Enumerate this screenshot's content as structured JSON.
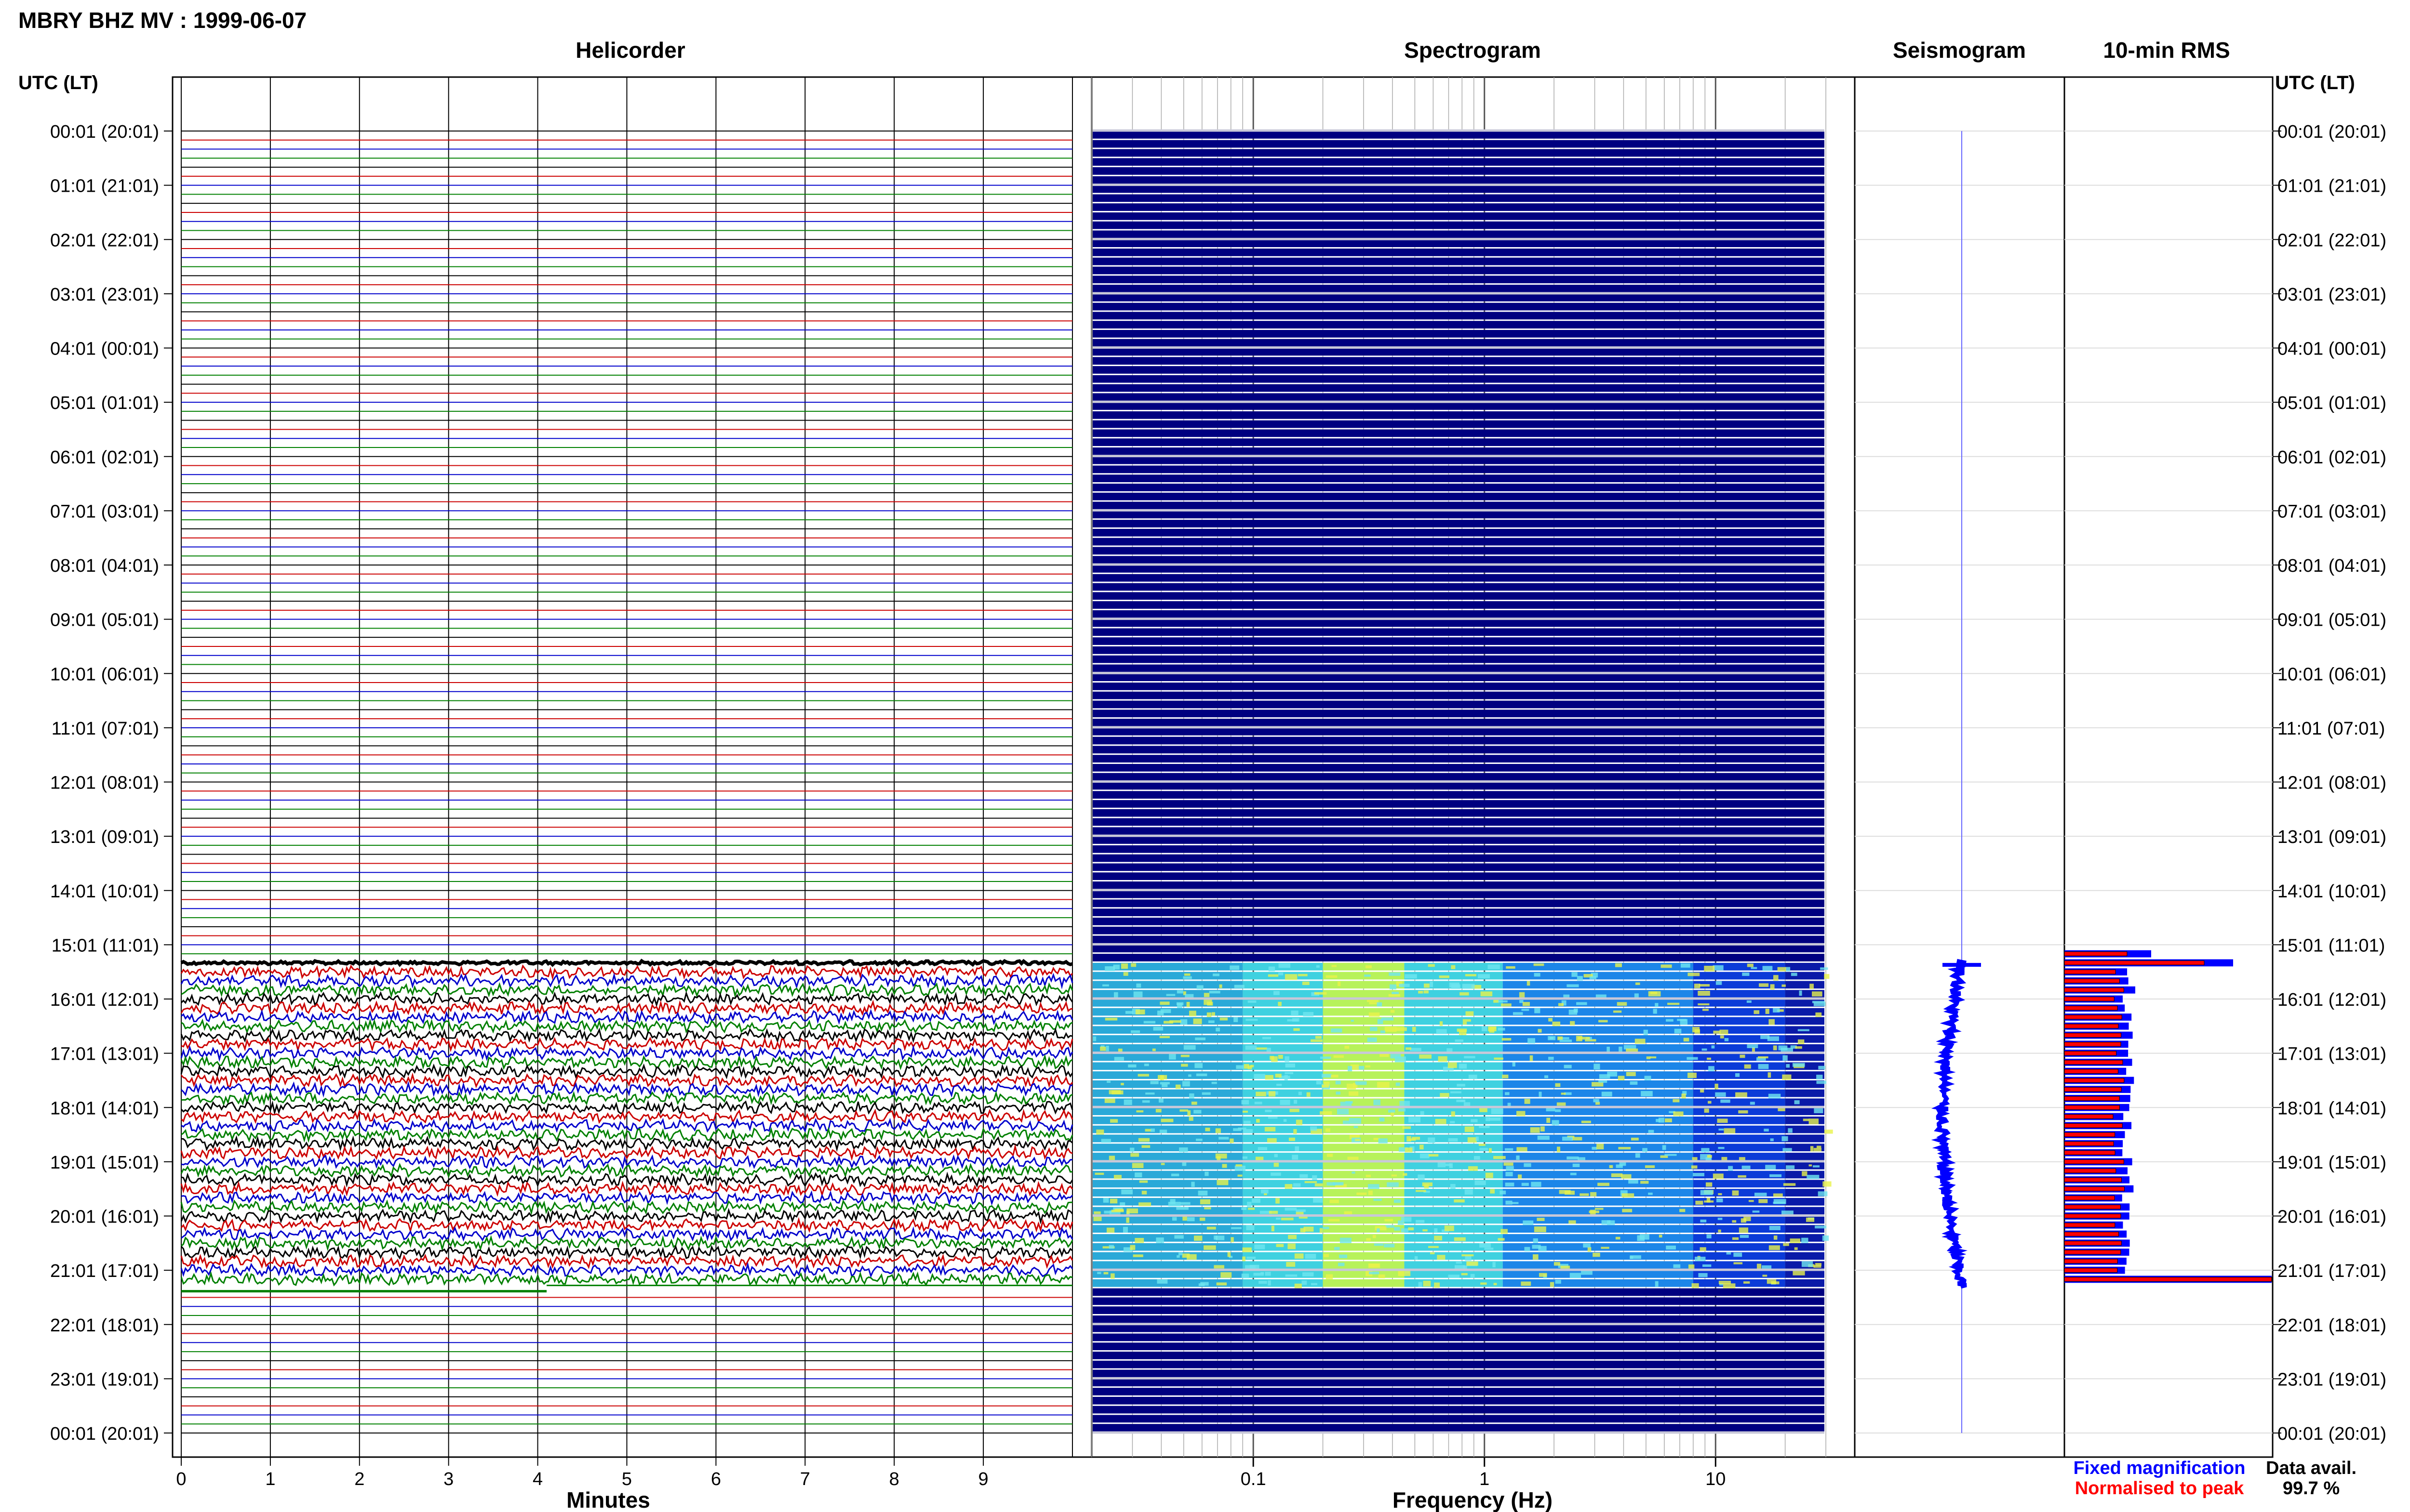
{
  "title": "MBRY BHZ MV : 1999-06-07",
  "panels": {
    "helicorder": "Helicorder",
    "spectrogram": "Spectrogram",
    "seismogram": "Seismogram",
    "rms": "10-min RMS"
  },
  "axis": {
    "time_header": "UTC (LT)",
    "helicorder_xlabel": "Minutes",
    "spectrogram_xlabel": "Frequency (Hz)"
  },
  "legend": {
    "fixed": "Fixed magnification",
    "normalised": "Normalised to peak",
    "fixed_color": "#0000ff",
    "normalised_color": "#ff0000"
  },
  "data_availability": {
    "label": "Data avail.",
    "value": "99.7 %"
  },
  "colors": {
    "trace_cycle": [
      "#000000",
      "#cc0000",
      "#0000cc",
      "#008000"
    ],
    "spectro_background": "#000080",
    "spectro_empty_line": "#c8c8d8"
  },
  "chart_data": [
    {
      "type": "line",
      "title": "Helicorder",
      "xlabel": "Minutes",
      "x_ticks": [
        "0",
        "1",
        "2",
        "3",
        "4",
        "5",
        "6",
        "7",
        "8",
        "9"
      ],
      "xlim": [
        0,
        10
      ],
      "row_labels": [
        "00:01 (20:01)",
        "01:01 (21:01)",
        "02:01 (22:01)",
        "03:01 (23:01)",
        "04:01 (00:01)",
        "05:01 (01:01)",
        "06:01 (02:01)",
        "07:01 (03:01)",
        "08:01 (04:01)",
        "09:01 (05:01)",
        "10:01 (06:01)",
        "11:01 (07:01)",
        "12:01 (08:01)",
        "13:01 (09:01)",
        "14:01 (10:01)",
        "15:01 (11:01)",
        "16:01 (12:01)",
        "17:01 (13:01)",
        "18:01 (14:01)",
        "19:01 (15:01)",
        "20:01 (16:01)",
        "21:01 (17:01)",
        "22:01 (18:01)",
        "23:01 (19:01)",
        "00:01 (20:01)"
      ],
      "minutes_per_line": 10,
      "data_start_hour": 15.3,
      "data_end_hour": 21.3
    },
    {
      "type": "heatmap",
      "title": "Spectrogram",
      "xlabel": "Frequency (Hz)",
      "x_scale": "log",
      "x_ticks": [
        "0.1",
        "1",
        "10"
      ],
      "xlim": [
        0.02,
        40
      ],
      "data_start_hour": 15.3,
      "data_end_hour": 21.3
    },
    {
      "type": "line",
      "title": "Seismogram",
      "data_start_hour": 15.3,
      "data_end_hour": 21.3
    },
    {
      "type": "bar",
      "title": "10-min RMS",
      "series": [
        {
          "name": "Fixed magnification",
          "color": "#0000ff"
        },
        {
          "name": "Normalised to peak",
          "color": "#ff0000"
        }
      ],
      "data_start_hour": 15.1,
      "data_end_hour": 21.3
    }
  ]
}
